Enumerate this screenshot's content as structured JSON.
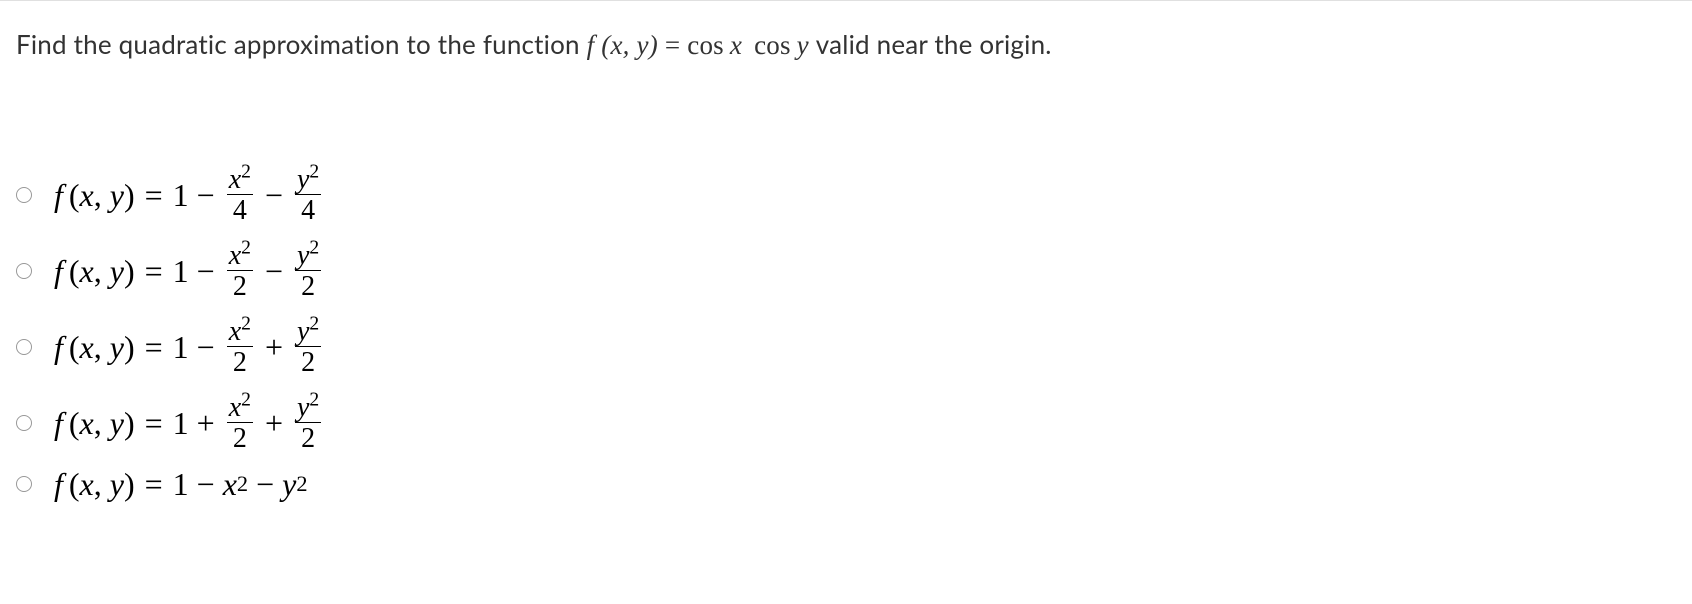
{
  "question": {
    "pre": "Find the quadratic approximation to the function ",
    "func": "f (x, y)",
    "equals": " = ",
    "expr_cos1": "cos",
    "expr_x": "x",
    "expr_cos2": "cos",
    "expr_y": "y",
    "post": " valid near the origin."
  },
  "options": [
    {
      "lhs_f": "f",
      "lhs_args": "(x, y)",
      "eq": "=",
      "term1": "1",
      "op1": "−",
      "frac1_num": "x",
      "frac1_sup": "2",
      "frac1_den": "4",
      "op2": "−",
      "frac2_num": "y",
      "frac2_sup": "2",
      "frac2_den": "4"
    },
    {
      "lhs_f": "f",
      "lhs_args": "(x, y)",
      "eq": "=",
      "term1": "1",
      "op1": "−",
      "frac1_num": "x",
      "frac1_sup": "2",
      "frac1_den": "2",
      "op2": "−",
      "frac2_num": "y",
      "frac2_sup": "2",
      "frac2_den": "2"
    },
    {
      "lhs_f": "f",
      "lhs_args": "(x, y)",
      "eq": "=",
      "term1": "1",
      "op1": "−",
      "frac1_num": "x",
      "frac1_sup": "2",
      "frac1_den": "2",
      "op2": "+",
      "frac2_num": "y",
      "frac2_sup": "2",
      "frac2_den": "2"
    },
    {
      "lhs_f": "f",
      "lhs_args": "(x, y)",
      "eq": "=",
      "term1": "1",
      "op1": "+",
      "frac1_num": "x",
      "frac1_sup": "2",
      "frac1_den": "2",
      "op2": "+",
      "frac2_num": "y",
      "frac2_sup": "2",
      "frac2_den": "2"
    }
  ],
  "option_flat": {
    "lhs_f": "f",
    "lhs_args": "(x, y)",
    "eq": "=",
    "term1": "1",
    "op1": "−",
    "t2_base": "x",
    "t2_sup": "2",
    "op2": "−",
    "t3_base": "y",
    "t3_sup": "2"
  }
}
